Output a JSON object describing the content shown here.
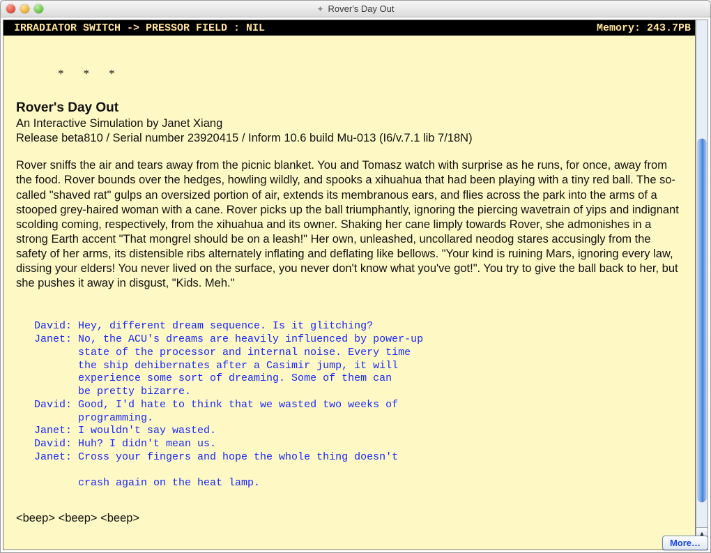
{
  "window": {
    "title": "Rover's Day Out"
  },
  "infobar": {
    "left": " IRRADIATOR SWITCH -> PRESSOR FIELD : NIL",
    "right": "Memory: 243.7PB"
  },
  "section_break": "*  *  *",
  "game": {
    "title": "Rover's Day Out",
    "subtitle": "An Interactive Simulation by Janet Xiang",
    "release": "Release beta810 / Serial number 23920415 / Inform 10.6 build Mu-013 (I6/v.7.1 lib 7/18N)"
  },
  "prose": "Rover sniffs the air and tears away from the picnic blanket. You and Tomasz watch with surprise as he runs, for once, away from the food. Rover bounds over the hedges, howling wildly, and spooks a xihuahua that had been playing with a tiny red ball. The so-called \"shaved rat\" gulps an oversized portion of air, extends its membranous ears, and flies across the park into the arms of a stooped grey-haired woman with a cane. Rover picks up the ball triumphantly, ignoring the piercing wavetrain of yips and indignant scolding coming, respectively, from the xihuahua and its owner. Shaking her cane limply towards Rover, she admonishes in a strong Earth accent \"That mongrel should be on a leash!\" Her own, unleashed, uncollared neodog stares accusingly from the safety of her arms, its distensible ribs alternately inflating and deflating like bellows. \"Your kind is ruining Mars, ignoring every law, dissing your elders! You never lived on the surface, you never don't know what you've got!\". You try to give the ball back to her, but she pushes it away in disgust, \"Kids. Meh.\"",
  "dialogue": "David: Hey, different dream sequence. Is it glitching?\nJanet: No, the ACU's dreams are heavily influenced by power-up\n       state of the processor and internal noise. Every time\n       the ship dehibernates after a Casimir jump, it will\n       experience some sort of dreaming. Some of them can\n       be pretty bizarre.\nDavid: Good, I'd hate to think that we wasted two weeks of\n       programming.\nJanet: I wouldn't say wasted.\nDavid: Huh? I didn't mean us.\nJanet: Cross your fingers and hope the whole thing doesn't\n\n       crash again on the heat lamp.",
  "beep": "<beep> <beep> <beep>",
  "more_label": "More…",
  "scroll_arrows": {
    "up": "▲",
    "down": "▼"
  }
}
